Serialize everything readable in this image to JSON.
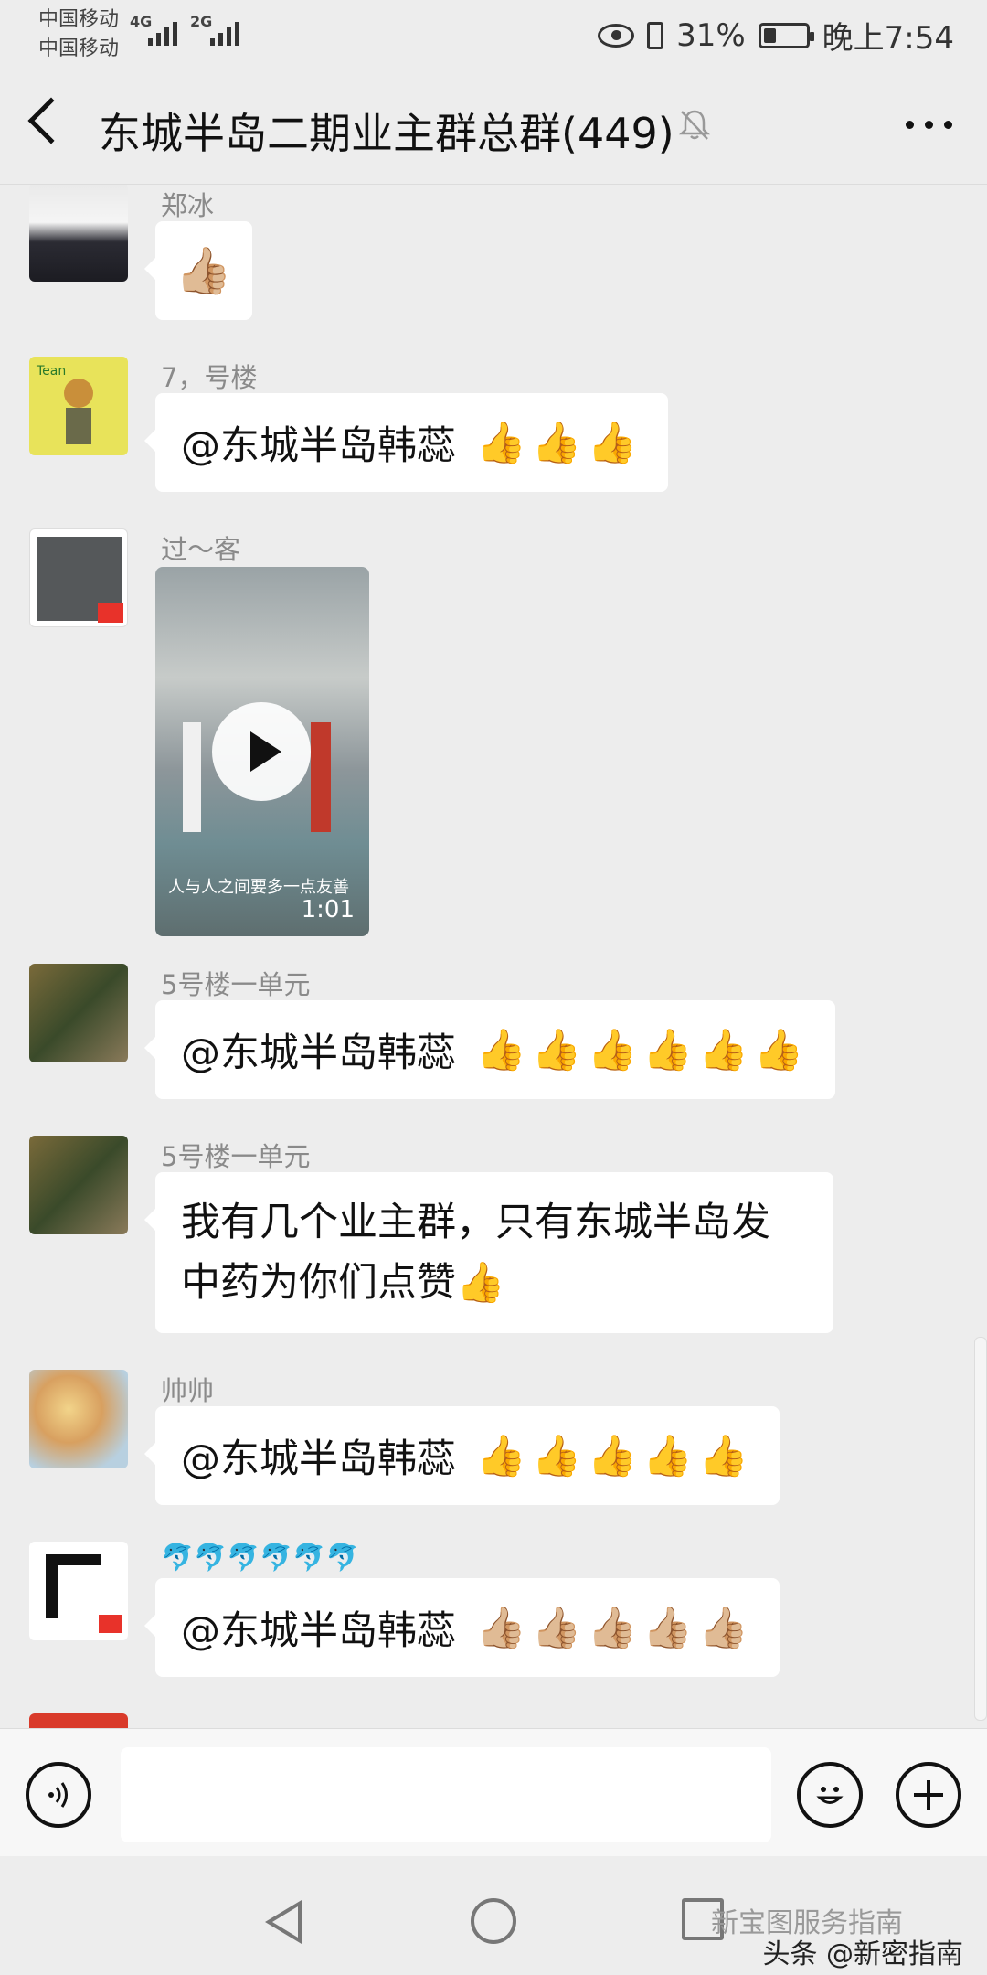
{
  "status_bar": {
    "carrier_1": "中国移动",
    "carrier_2": "中国移动",
    "network_1": "4G",
    "network_2": "2G",
    "battery": "31%",
    "time": "晚上7:54"
  },
  "nav": {
    "title": "东城半岛二期业主群总群(449)"
  },
  "messages": [
    {
      "sender": "郑冰",
      "text": "",
      "thumbs": "👍🏼"
    },
    {
      "sender": "7，号楼",
      "text": "@东城半岛韩蕊",
      "thumbs": "👍👍👍"
    },
    {
      "sender": "过～客",
      "video_caption": "人与人之间要多一点友善",
      "video_duration": "1:01"
    },
    {
      "sender": "5号楼一单元",
      "text": "@东城半岛韩蕊",
      "thumbs": "👍👍👍👍👍👍"
    },
    {
      "sender": "5号楼一单元",
      "text_line1": "我有几个业主群，只有东城半岛发",
      "text_line2": "中药为你们点赞",
      "thumbs": "👍"
    },
    {
      "sender": "帅帅",
      "text": "@东城半岛韩蕊",
      "thumbs": "👍👍👍👍👍"
    },
    {
      "sender": "🐬🐬🐬🐬🐬🐬",
      "text": "@东城半岛韩蕊",
      "thumbs": "👍🏼👍🏼👍🏼👍🏼👍🏼"
    }
  ],
  "watermark": {
    "faded": "新宝图服务指南",
    "text": "头条 @新密指南"
  }
}
